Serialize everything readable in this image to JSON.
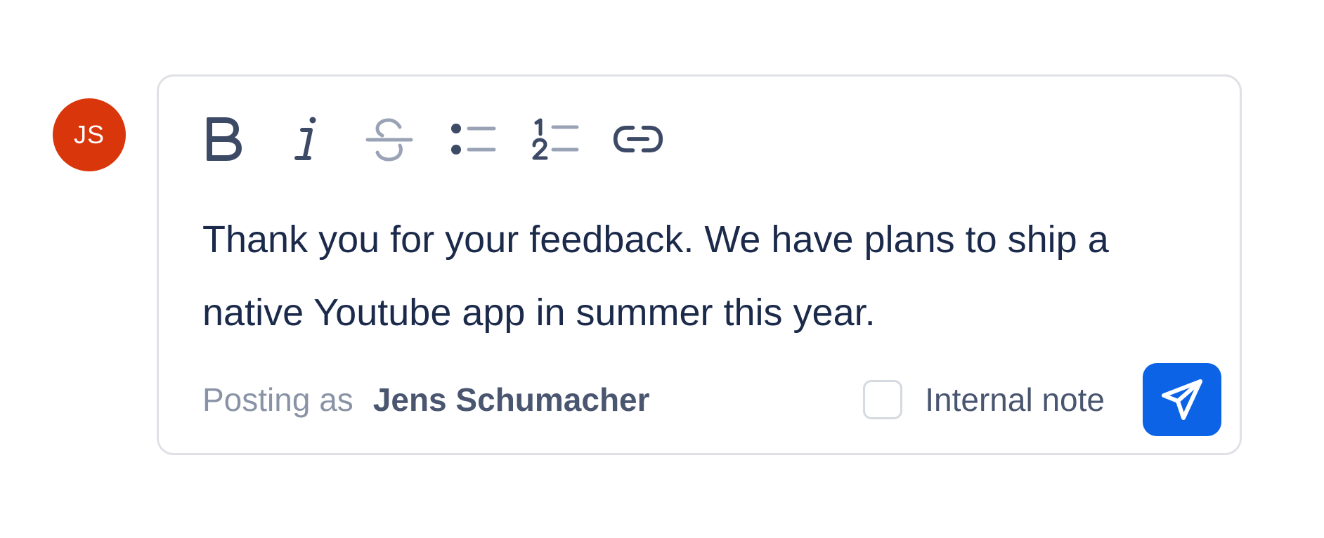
{
  "avatar": {
    "initials": "JS",
    "color": "#d9360b"
  },
  "toolbar": {
    "tools": [
      {
        "name": "bold",
        "icon": "bold-icon"
      },
      {
        "name": "italic",
        "icon": "italic-icon"
      },
      {
        "name": "strikethrough",
        "icon": "strikethrough-icon"
      },
      {
        "name": "bullet-list",
        "icon": "bullet-list-icon"
      },
      {
        "name": "numbered-list",
        "icon": "numbered-list-icon"
      },
      {
        "name": "link",
        "icon": "link-icon"
      }
    ]
  },
  "editor": {
    "text": "Thank you for your feedback. We have plans to ship a native Youtube app in summer this year."
  },
  "footer": {
    "posting_prefix": "Posting as",
    "posting_name": "Jens Schumacher",
    "internal_note_label": "Internal note",
    "internal_note_checked": false,
    "send_icon": "paper-plane-icon",
    "send_color": "#0d63e6"
  }
}
